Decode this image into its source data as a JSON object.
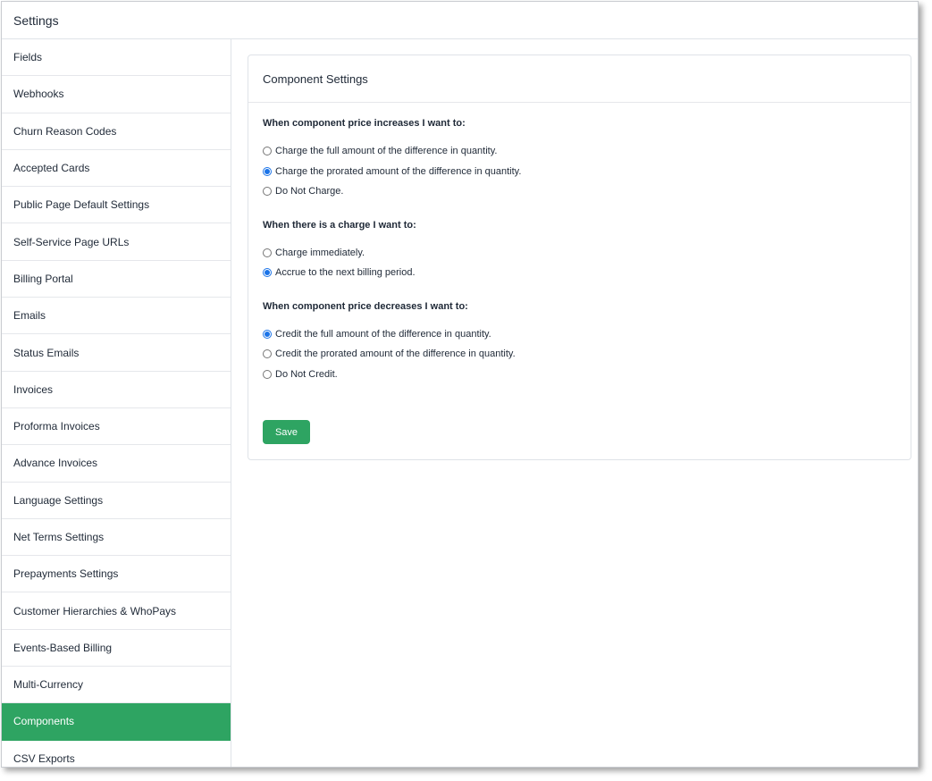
{
  "header": {
    "title": "Settings"
  },
  "sidebar": {
    "items": [
      {
        "label": "Fields",
        "active": false
      },
      {
        "label": "Webhooks",
        "active": false
      },
      {
        "label": "Churn Reason Codes",
        "active": false
      },
      {
        "label": "Accepted Cards",
        "active": false
      },
      {
        "label": "Public Page Default Settings",
        "active": false
      },
      {
        "label": "Self-Service Page URLs",
        "active": false
      },
      {
        "label": "Billing Portal",
        "active": false
      },
      {
        "label": "Emails",
        "active": false
      },
      {
        "label": "Status Emails",
        "active": false
      },
      {
        "label": "Invoices",
        "active": false
      },
      {
        "label": "Proforma Invoices",
        "active": false
      },
      {
        "label": "Advance Invoices",
        "active": false
      },
      {
        "label": "Language Settings",
        "active": false
      },
      {
        "label": "Net Terms Settings",
        "active": false
      },
      {
        "label": "Prepayments Settings",
        "active": false
      },
      {
        "label": "Customer Hierarchies & WhoPays",
        "active": false
      },
      {
        "label": "Events-Based Billing",
        "active": false
      },
      {
        "label": "Multi-Currency",
        "active": false
      },
      {
        "label": "Components",
        "active": true
      },
      {
        "label": "CSV Exports",
        "active": false
      }
    ]
  },
  "card": {
    "title": "Component Settings",
    "groups": [
      {
        "label": "When component price increases I want to:",
        "options": [
          {
            "label": "Charge the full amount of the difference in quantity.",
            "checked": false
          },
          {
            "label": "Charge the prorated amount of the difference in quantity.",
            "checked": true
          },
          {
            "label": "Do Not Charge.",
            "checked": false
          }
        ]
      },
      {
        "label": "When there is a charge I want to:",
        "options": [
          {
            "label": "Charge immediately.",
            "checked": false
          },
          {
            "label": "Accrue to the next billing period.",
            "checked": true
          }
        ]
      },
      {
        "label": "When component price decreases I want to:",
        "options": [
          {
            "label": "Credit the full amount of the difference in quantity.",
            "checked": true
          },
          {
            "label": "Credit the prorated amount of the difference in quantity.",
            "checked": false
          },
          {
            "label": "Do Not Credit.",
            "checked": false
          }
        ]
      }
    ],
    "save_label": "Save"
  },
  "colors": {
    "accent": "#2ea462",
    "radio": "#1a73e8"
  }
}
